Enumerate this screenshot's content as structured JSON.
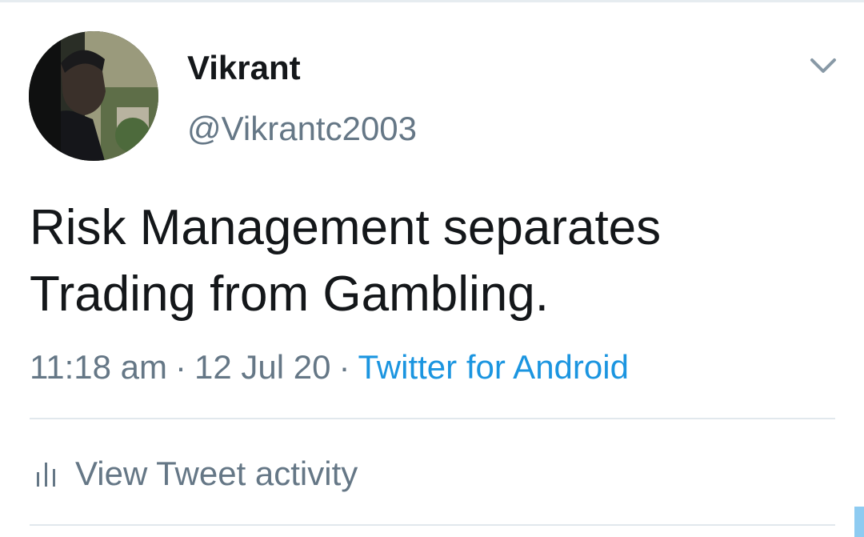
{
  "tweet": {
    "author": {
      "name": "Vikrant",
      "handle": "@Vikrantc2003"
    },
    "text": "Risk Management separates Trading from Gambling.",
    "time": "11:18 am",
    "separator": "·",
    "date": "12 Jul 20",
    "source": "Twitter for Android"
  },
  "actions": {
    "activity_label": "View Tweet activity"
  },
  "icons": {
    "menu": "chevron-down-icon",
    "activity": "bar-chart-icon"
  },
  "colors": {
    "text_primary": "#14171a",
    "text_secondary": "#657786",
    "link": "#1b95e0",
    "divider": "#e1e8ed"
  }
}
